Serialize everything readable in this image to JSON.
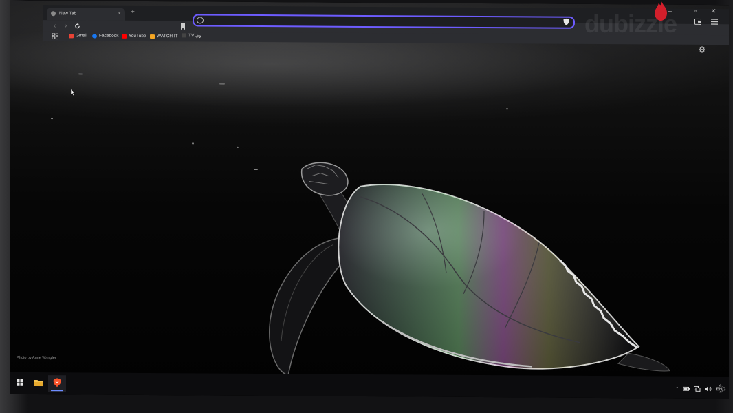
{
  "browser": {
    "tab": {
      "title": "New Tab",
      "close_glyph": "×"
    },
    "new_tab_glyph": "+",
    "omnibox": {
      "value": "",
      "placeholder": ""
    },
    "bookmarks": [
      {
        "label": "Gmail",
        "color": "#ea4335"
      },
      {
        "label": "Facebook",
        "color": "#1877f2"
      },
      {
        "label": "YouTube",
        "color": "#ff0000"
      },
      {
        "label": "WATCH IT",
        "color": "#f5a623"
      },
      {
        "label": "TV وي",
        "color": "#444444"
      }
    ],
    "window_controls": {
      "minimize": "–",
      "restore": "▫",
      "close": "✕"
    }
  },
  "wallpaper": {
    "credit": "Photo by Anne Wangler"
  },
  "taskbar": {
    "tray": {
      "language": "ENG"
    },
    "clock": {
      "time": "4:",
      "date": "2/"
    }
  },
  "watermark": {
    "text": "dubizzle"
  },
  "colors": {
    "accent": "#6d5cff",
    "brave": "#fb542b",
    "chrome_bg": "#2c2d31",
    "titlebar_bg": "#1e1f22"
  }
}
